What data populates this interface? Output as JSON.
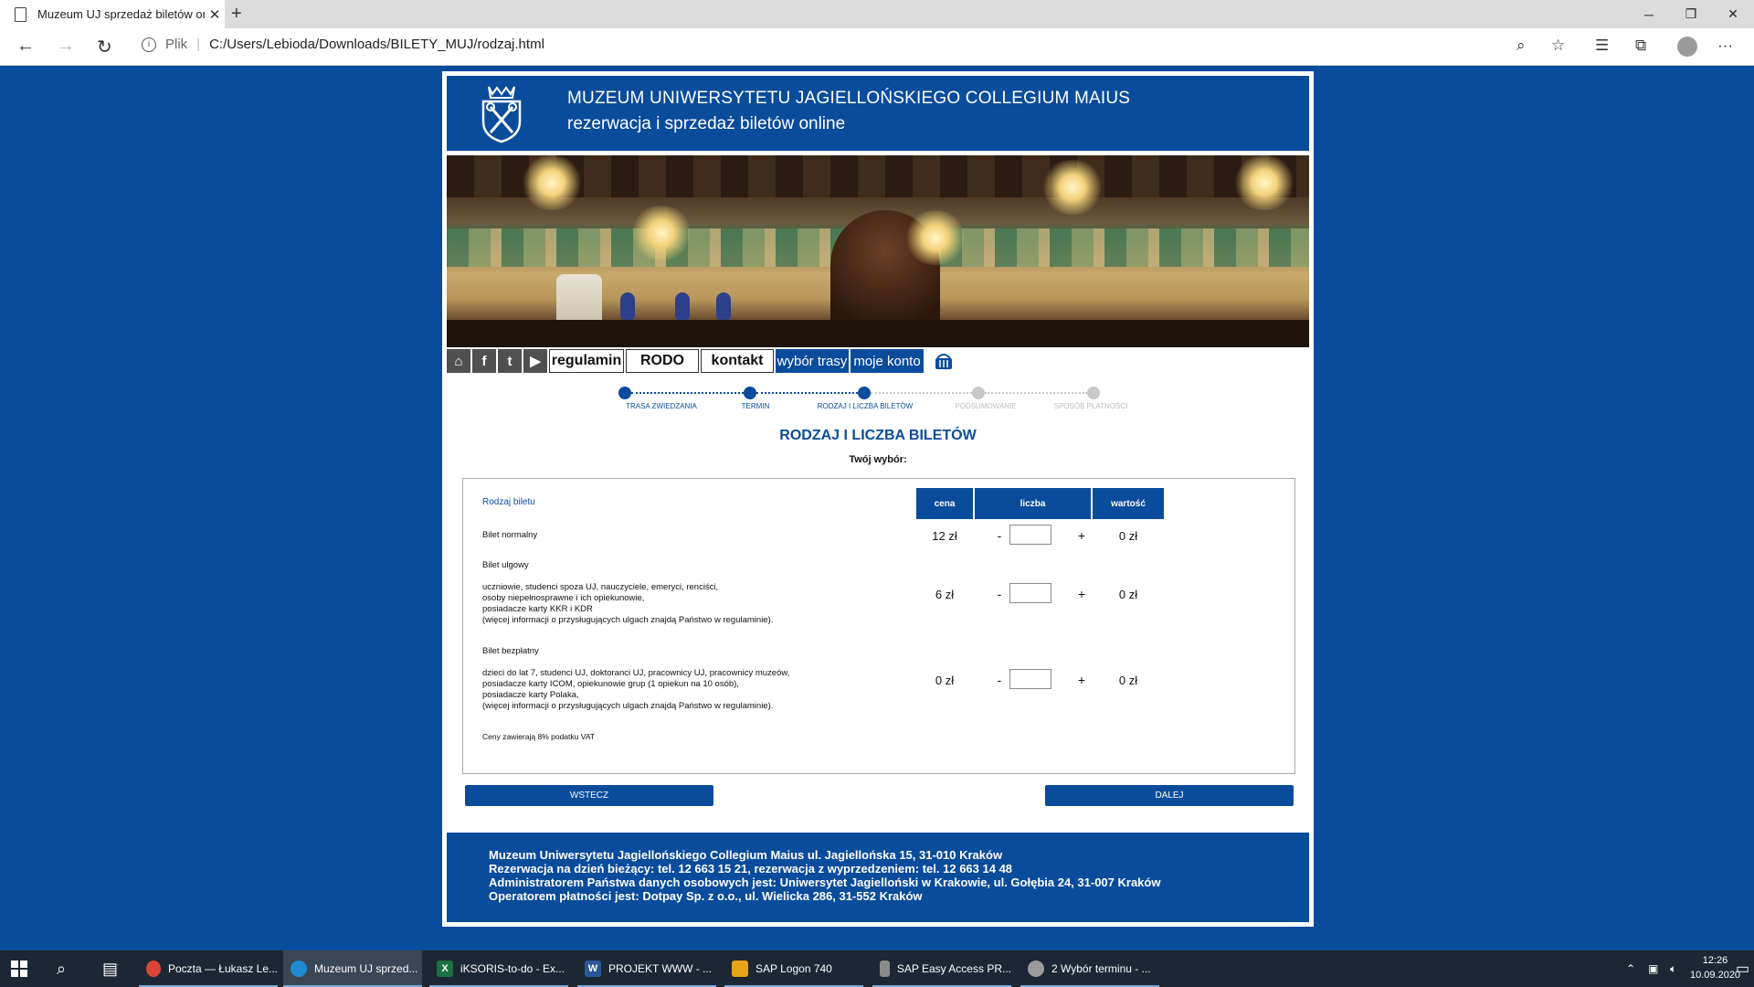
{
  "browser": {
    "tab_title": "Muzeum UJ sprzedaż biletów on",
    "tab_close": "✕",
    "new_tab": "+",
    "url_prefix": "Plik",
    "url": "C:/Users/Lebioda/Downloads/BILETY_MUJ/rodzaj.html",
    "more": "···"
  },
  "header": {
    "title": "MUZEUM UNIWERSYTETU JAGIELLOŃSKIEGO COLLEGIUM MAIUS",
    "subtitle": "rezerwacja i sprzedaż biletów online"
  },
  "nav": {
    "items": [
      "regulamin",
      "RODO",
      "kontakt",
      "wybór trasy",
      "moje konto"
    ],
    "icons": [
      "home-icon",
      "facebook-icon",
      "twitter-icon",
      "play-icon",
      "basket-icon"
    ]
  },
  "steps": [
    {
      "label": "TRASA ZWIEDZANIA",
      "active": true
    },
    {
      "label": "TERMIN",
      "active": true
    },
    {
      "label": "RODZAJ I LICZBA BILETÓW",
      "active": true
    },
    {
      "label": "PODSUMOWANIE",
      "active": false
    },
    {
      "label": "SPOSÓB PŁATNOŚCI",
      "active": false
    }
  ],
  "main": {
    "heading": "RODZAJ I LICZBA BILETÓW",
    "choice_label": "Twój wybór:"
  },
  "table": {
    "col_type": "Rodzaj biletu",
    "col_price": "cena",
    "col_qty": "liczba",
    "col_value": "wartość",
    "rows": [
      {
        "name": "Bilet normalny",
        "desc": [],
        "price": "12 zł",
        "minus": "-",
        "plus": "+",
        "qty": "",
        "value": "0 zł"
      },
      {
        "name": "Bilet ulgowy",
        "desc": [
          "uczniowie, studenci spoza UJ, nauczyciele, emeryci, renciści,",
          "osoby niepełnosprawne i ich opiekunowie,",
          "posiadacze karty KKR i KDR",
          "(więcej informacji o przysługujących ulgach znajdą Państwo w regulaminie)."
        ],
        "price": "6 zł",
        "minus": "-",
        "plus": "+",
        "qty": "",
        "value": "0 zł"
      },
      {
        "name": "Bilet bezpłatny",
        "desc": [
          "dzieci do lat 7, studenci UJ, doktoranci UJ, pracownicy UJ, pracownicy muzeów,",
          "posiadacze karty ICOM, opiekunowie grup (1 opiekun na 10 osób),",
          "posiadacze karty Polaka,",
          "(więcej informacji o przysługujących ulgach znajdą Państwo w regulaminie)."
        ],
        "price": "0 zł",
        "minus": "-",
        "plus": "+",
        "qty": "",
        "value": "0 zł"
      }
    ],
    "vat_note": "Ceny zawierają 8% podatku VAT"
  },
  "buttons": {
    "back": "WSTECZ",
    "next": "DALEJ"
  },
  "footer": {
    "lines": [
      "Muzeum Uniwersytetu Jagiellońskiego Collegium Maius ul. Jagiellońska 15, 31-010 Kraków",
      "Rezerwacja na dzień bieżący: tel. 12 663 15 21, rezerwacja z wyprzedzeniem: tel. 12 663 14 48",
      "Administratorem Państwa danych osobowych jest: Uniwersytet Jagielloński w Krakowie, ul. Gołębia 24, 31-007 Kraków",
      "Operatorem płatności jest: Dotpay Sp. z o.o., ul. Wielicka 286, 31-552 Kraków"
    ]
  },
  "taskbar": {
    "apps": [
      {
        "label": "Poczta — Łukasz Le...",
        "icon": "chrome-icon",
        "color": "#db4437"
      },
      {
        "label": "Muzeum UJ sprzed...",
        "icon": "edge-icon",
        "color": "#1f8ad2"
      },
      {
        "label": "iKSORIS-to-do - Ex...",
        "icon": "excel-icon",
        "color": "#1d7044"
      },
      {
        "label": "PROJEKT WWW - ...",
        "icon": "word-icon",
        "color": "#2b579a"
      },
      {
        "label": "SAP Logon 740",
        "icon": "sap-logon-icon",
        "color": "#e8a317"
      },
      {
        "label": "SAP Easy Access PR...",
        "icon": "sap-window-icon",
        "color": "#8a8a8a"
      },
      {
        "label": "2 Wybór terminu - ...",
        "icon": "sap-gui-icon",
        "color": "#9b9b9b"
      }
    ],
    "time": "12:26",
    "date": "10.09.2020"
  }
}
